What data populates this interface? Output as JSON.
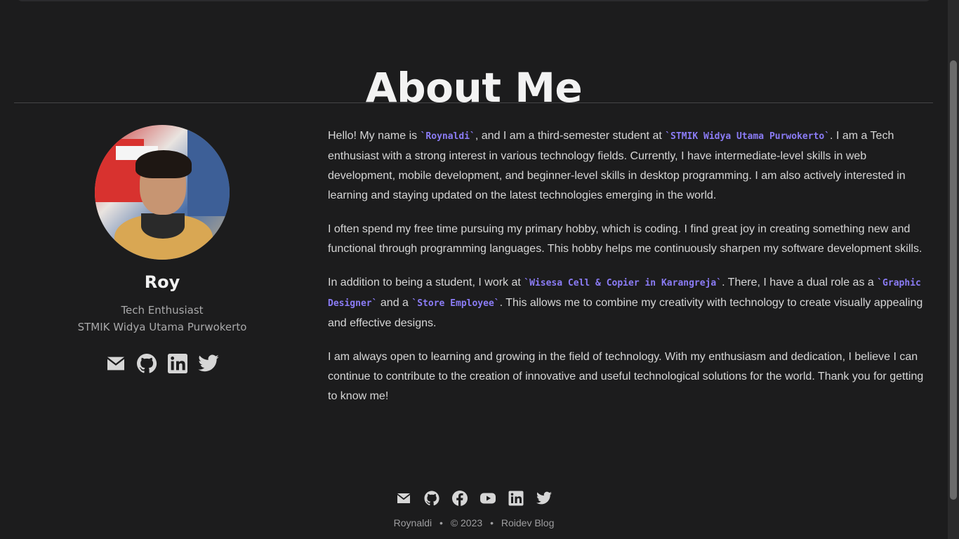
{
  "page": {
    "title": "About Me"
  },
  "profile": {
    "name": "Roy",
    "role": "Tech Enthusiast",
    "school": "STMIK Widya Utama Purwokerto",
    "social": [
      "mail-icon",
      "github-icon",
      "linkedin-icon",
      "twitter-icon"
    ]
  },
  "about": {
    "p1": {
      "t1": "Hello! My name is ",
      "c1": "`Roynaldi`",
      "t2": ", and I am a third-semester student at ",
      "c2": "`STMIK Widya Utama Purwokerto`",
      "t3": ". I am a Tech enthusiast with a strong interest in various technology fields. Currently, I have intermediate-level skills in web development, mobile development, and beginner-level skills in desktop programming. I am also actively interested in learning and staying updated on the latest technologies emerging in the world."
    },
    "p2": "I often spend my free time pursuing my primary hobby, which is coding. I find great joy in creating something new and functional through programming languages. This hobby helps me continuously sharpen my software development skills.",
    "p3": {
      "t1": "In addition to being a student, I work at ",
      "c1": "`Wisesa Cell & Copier in Karangreja`",
      "t2": ". There, I have a dual role as a ",
      "c2": "`Graphic Designer`",
      "t3": " and a ",
      "c3": "`Store Employee`",
      "t4": ". This allows me to combine my creativity with technology to create visually appealing and effective designs."
    },
    "p4": "I am always open to learning and growing in the field of technology. With my enthusiasm and dedication, I believe I can continue to contribute to the creation of innovative and useful technological solutions for the world. Thank you for getting to know me!"
  },
  "footer": {
    "icons": [
      "mail-icon",
      "github-icon",
      "facebook-icon",
      "youtube-icon",
      "linkedin-icon",
      "twitter-icon"
    ],
    "author": "Roynaldi",
    "bullet": "•",
    "copyright": "© 2023",
    "blog": "Roidev Blog"
  },
  "colors": {
    "background": "#1c1c1d",
    "accent_code": "#8b7cf6",
    "text": "#d6d6d6"
  }
}
